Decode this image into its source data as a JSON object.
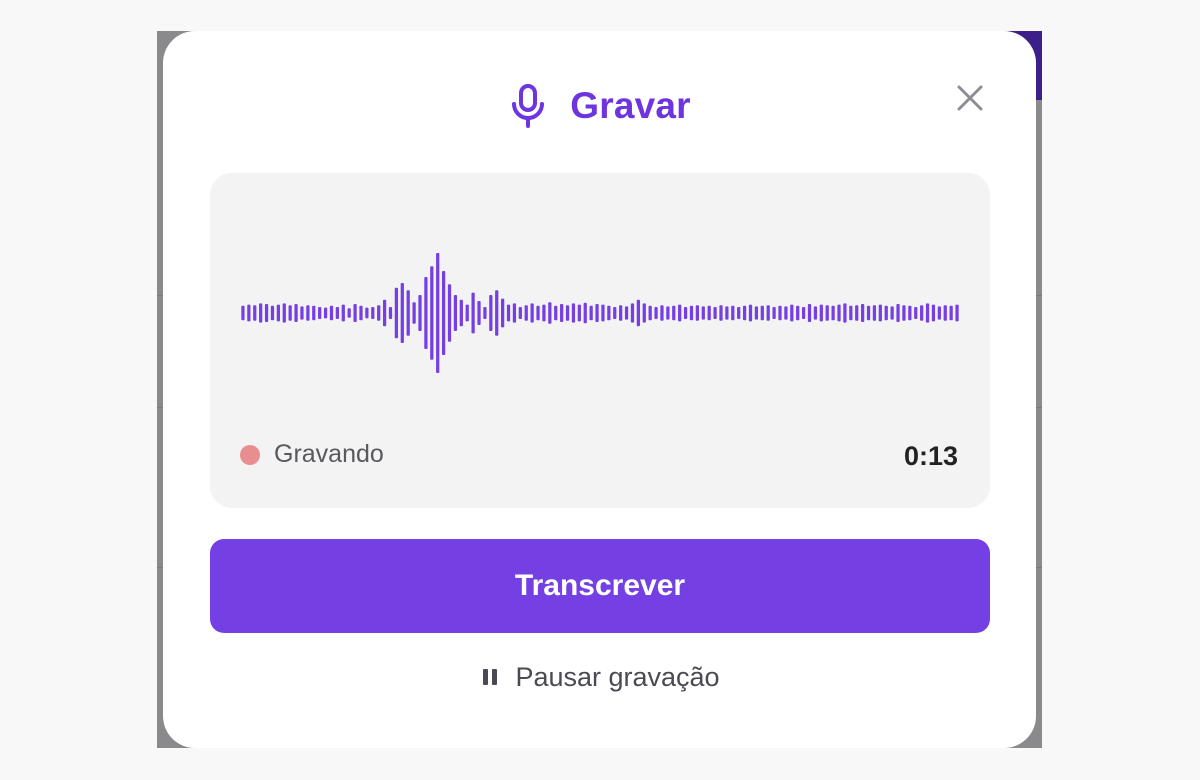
{
  "modal": {
    "title": "Gravar",
    "icons": {
      "title_icon": "microphone-icon",
      "close": "close-icon",
      "pause": "pause-icon"
    },
    "colors": {
      "accent": "#7540e3",
      "title": "#6d34df",
      "recording_dot": "#e88e8e"
    }
  },
  "recorder": {
    "status": "Gravando",
    "elapsed": "0:13",
    "waveform_levels": [
      0.12,
      0.14,
      0.13,
      0.16,
      0.15,
      0.12,
      0.14,
      0.16,
      0.13,
      0.15,
      0.11,
      0.13,
      0.12,
      0.1,
      0.09,
      0.12,
      0.1,
      0.14,
      0.08,
      0.15,
      0.12,
      0.09,
      0.1,
      0.13,
      0.22,
      0.1,
      0.42,
      0.5,
      0.38,
      0.18,
      0.3,
      0.6,
      0.78,
      1.0,
      0.7,
      0.48,
      0.3,
      0.22,
      0.14,
      0.34,
      0.2,
      0.1,
      0.3,
      0.38,
      0.24,
      0.14,
      0.16,
      0.1,
      0.13,
      0.16,
      0.12,
      0.14,
      0.18,
      0.12,
      0.15,
      0.13,
      0.16,
      0.14,
      0.17,
      0.12,
      0.15,
      0.14,
      0.12,
      0.1,
      0.13,
      0.11,
      0.16,
      0.22,
      0.16,
      0.12,
      0.1,
      0.13,
      0.11,
      0.12,
      0.14,
      0.1,
      0.12,
      0.13,
      0.11,
      0.12,
      0.1,
      0.13,
      0.11,
      0.12,
      0.1,
      0.12,
      0.14,
      0.11,
      0.12,
      0.13,
      0.1,
      0.12,
      0.11,
      0.14,
      0.12,
      0.1,
      0.15,
      0.11,
      0.14,
      0.13,
      0.12,
      0.14,
      0.16,
      0.12,
      0.13,
      0.15,
      0.12,
      0.13,
      0.14,
      0.12,
      0.11,
      0.15,
      0.13,
      0.12,
      0.1,
      0.13,
      0.16,
      0.14,
      0.11,
      0.13,
      0.12,
      0.14
    ]
  },
  "actions": {
    "transcribe_label": "Transcrever",
    "pause_label": "Pausar gravação"
  }
}
